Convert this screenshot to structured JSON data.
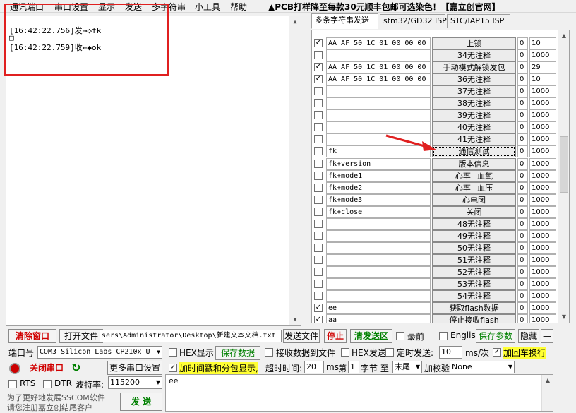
{
  "menu": [
    "通讯端口",
    "串口设置",
    "显示",
    "发送",
    "多字符串",
    "小工具",
    "帮助"
  ],
  "banner": "▲PCB打样降至每款30元顺丰包邮可选染色！【嘉立创官网】",
  "receive": {
    "lines": [
      {
        "text": "[16:42:22.756]发→◇fk"
      },
      {
        "text": "□"
      },
      {
        "text": "[16:42:22.759]收←◆ok"
      }
    ]
  },
  "tabs": [
    "多条字符串发送",
    "stm32/GD32 ISP",
    "STC/IAP15 ISP"
  ],
  "multi_rows": [
    {
      "checked": true,
      "cmd": "AA AF 50 1C 01 00 00 00",
      "label": "上锁",
      "n1": "0",
      "n2": "10"
    },
    {
      "checked": false,
      "cmd": "",
      "label": "34无注释",
      "n1": "0",
      "n2": "1000"
    },
    {
      "checked": true,
      "cmd": "AA AF 50 1C 01 00 00 00",
      "label": "手动模式解锁发包",
      "n1": "0",
      "n2": "29"
    },
    {
      "checked": true,
      "cmd": "AA AF 50 1C 01 00 00 00",
      "label": "36无注释",
      "n1": "0",
      "n2": "10"
    },
    {
      "checked": false,
      "cmd": "",
      "label": "37无注释",
      "n1": "0",
      "n2": "1000"
    },
    {
      "checked": false,
      "cmd": "",
      "label": "38无注释",
      "n1": "0",
      "n2": "1000"
    },
    {
      "checked": false,
      "cmd": "",
      "label": "39无注释",
      "n1": "0",
      "n2": "1000"
    },
    {
      "checked": false,
      "cmd": "",
      "label": "40无注释",
      "n1": "0",
      "n2": "1000"
    },
    {
      "checked": false,
      "cmd": "",
      "label": "41无注释",
      "n1": "0",
      "n2": "1000"
    },
    {
      "checked": false,
      "cmd": "fk",
      "label": "通信测试",
      "n1": "0",
      "n2": "1000",
      "focus": true
    },
    {
      "checked": false,
      "cmd": "fk+version",
      "label": "版本信息",
      "n1": "0",
      "n2": "1000"
    },
    {
      "checked": false,
      "cmd": "fk+mode1",
      "label": "心率+血氧",
      "n1": "0",
      "n2": "1000"
    },
    {
      "checked": false,
      "cmd": "fk+mode2",
      "label": "心率+血压",
      "n1": "0",
      "n2": "1000"
    },
    {
      "checked": false,
      "cmd": "fk+mode3",
      "label": "心电图",
      "n1": "0",
      "n2": "1000"
    },
    {
      "checked": false,
      "cmd": "fk+close",
      "label": "关闭",
      "n1": "0",
      "n2": "1000"
    },
    {
      "checked": false,
      "cmd": "",
      "label": "48无注释",
      "n1": "0",
      "n2": "1000"
    },
    {
      "checked": false,
      "cmd": "",
      "label": "49无注释",
      "n1": "0",
      "n2": "1000"
    },
    {
      "checked": false,
      "cmd": "",
      "label": "50无注释",
      "n1": "0",
      "n2": "1000"
    },
    {
      "checked": false,
      "cmd": "",
      "label": "51无注释",
      "n1": "0",
      "n2": "1000"
    },
    {
      "checked": false,
      "cmd": "",
      "label": "52无注释",
      "n1": "0",
      "n2": "1000"
    },
    {
      "checked": false,
      "cmd": "",
      "label": "53无注释",
      "n1": "0",
      "n2": "1000"
    },
    {
      "checked": false,
      "cmd": "",
      "label": "54无注释",
      "n1": "0",
      "n2": "1000"
    },
    {
      "checked": true,
      "cmd": "ee",
      "label": "获取flash数据",
      "n1": "0",
      "n2": "1000"
    },
    {
      "checked": true,
      "cmd": "aa",
      "label": "停止接收flash",
      "n1": "0",
      "n2": "1000"
    }
  ],
  "toolbar": {
    "clear_window": "清除窗口",
    "open_file": "打开文件",
    "file_path": "sers\\Administrator\\Desktop\\新建文本文档.txt",
    "send_file": "发送文件",
    "stop": "停止",
    "clear_send": "清发送区",
    "front": "最前",
    "english": "English",
    "save_params": "保存参数",
    "hide": "隐藏",
    "dash": "—"
  },
  "port": {
    "label": "端口号",
    "value": "COM3 Silicon Labs CP210x U",
    "close_port": "关闭串口",
    "more_settings": "更多串口设置",
    "rts": "RTS",
    "dtr": "DTR",
    "baud_label": "波特率:",
    "baud": "115200"
  },
  "options": {
    "hex_display": "HEX显示",
    "save_data": "保存数据",
    "recv_to_file": "接收数据到文件",
    "hex_send": "HEX发送",
    "timed_send": "定时发送:",
    "interval": "10",
    "interval_unit": "ms/次",
    "append_crlf": "加回车换行",
    "timestamp": "加时间戳和分包显示,",
    "timeout_label": "超时时间:",
    "timeout": "20",
    "timeout_unit": "ms",
    "byte_prefix": "第",
    "byte_index": "1",
    "byte_label": "字节 至",
    "byte_end": "末尾",
    "checksum_label": "加校验",
    "checksum": "None"
  },
  "send": {
    "text": "ee",
    "button": "发 送",
    "footer1": "为了更好地发展SSCOM软件",
    "footer2": "请您注册嘉立创结尾客户"
  }
}
